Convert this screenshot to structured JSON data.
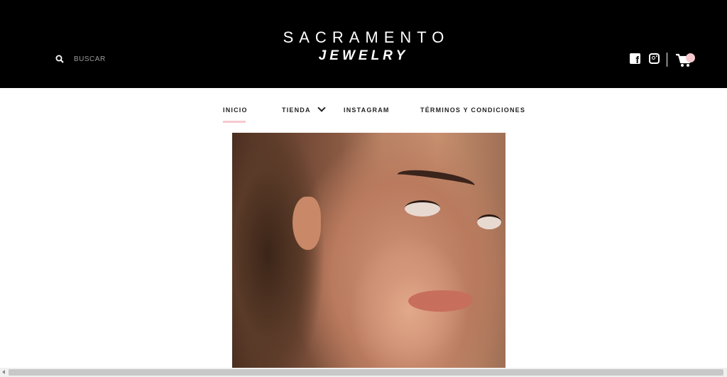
{
  "header": {
    "search": {
      "placeholder": "BUSCAR",
      "icon": "search-icon"
    },
    "logo": {
      "line1": "SACRAMENTO",
      "line2": "JEWELRY"
    },
    "social": {
      "facebook_icon": "facebook-icon",
      "facebook_glyph": "f",
      "instagram_icon": "instagram-icon"
    },
    "cart": {
      "icon": "cart-icon",
      "badge_color": "#f6c9cf"
    }
  },
  "nav": {
    "items": [
      {
        "label": "INICIO",
        "active": true
      },
      {
        "label": "TIENDA",
        "has_dropdown": true
      },
      {
        "label": "INSTAGRAM"
      },
      {
        "label": "TÉRMINOS Y CONDICIONES"
      }
    ],
    "accent": "#f6c9cf"
  },
  "hero": {
    "image": "woman-with-gold-earrings-portrait"
  }
}
